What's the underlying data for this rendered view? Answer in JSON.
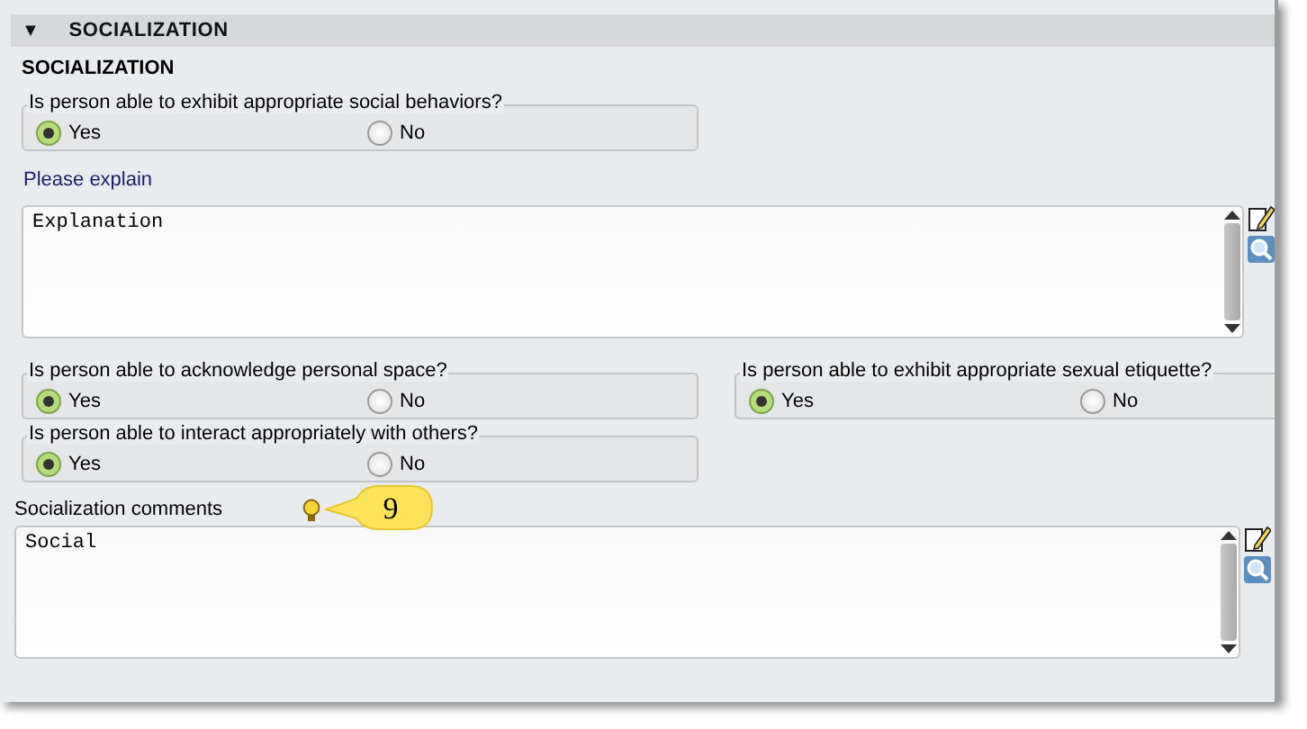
{
  "header": {
    "toggle": "▼",
    "title": "SOCIALIZATION"
  },
  "section_title": "SOCIALIZATION",
  "questions": [
    {
      "question": "Is person able to exhibit appropriate social behaviors?",
      "options": [
        {
          "label": "Yes",
          "selected": true
        },
        {
          "label": "No",
          "selected": false
        }
      ]
    },
    {
      "question": "Is person able to acknowledge personal space?",
      "options": [
        {
          "label": "Yes",
          "selected": true
        },
        {
          "label": "No",
          "selected": false
        }
      ]
    },
    {
      "question": "Is person able to exhibit appropriate sexual etiquette?",
      "options": [
        {
          "label": "Yes",
          "selected": true
        },
        {
          "label": "No",
          "selected": false
        }
      ]
    },
    {
      "question": "Is person able to interact appropriately with others?",
      "options": [
        {
          "label": "Yes",
          "selected": true
        },
        {
          "label": "No",
          "selected": false
        }
      ]
    }
  ],
  "explain": {
    "label": "Please explain",
    "value": "Explanation"
  },
  "comments": {
    "label": "Socialization comments",
    "value": "Social",
    "callout": "9"
  }
}
